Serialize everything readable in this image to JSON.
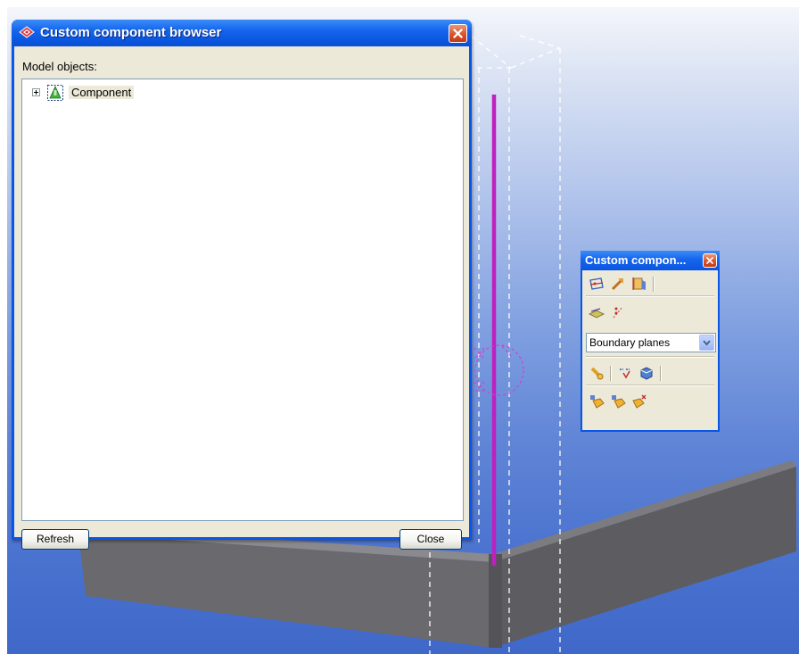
{
  "browser": {
    "title": "Custom component browser",
    "model_objects_label": "Model objects:",
    "tree": [
      {
        "label": "Component",
        "expanded": false
      }
    ],
    "refresh_label": "Refresh",
    "close_label": "Close"
  },
  "palette": {
    "title": "Custom compon...",
    "combo_value": "Boundary planes",
    "rows": [
      [
        "define-points-icon",
        "pick-direction-icon",
        "add-plate-icon"
      ],
      [
        "plane-offset-icon",
        "add-distance-icon"
      ],
      [
        "add-magnetic-icon",
        "bind-parametric-icon",
        "add-element-icon"
      ],
      [
        "add-bound-plane-icon",
        "remove-bound-plane-icon",
        "delete-binding-icon"
      ]
    ]
  },
  "colors": {
    "xp_blue": "#0a56e6",
    "dialog_face": "#ece9d8",
    "beam_magenta": "#c020c0",
    "plate_gray": "#6d6c70"
  }
}
